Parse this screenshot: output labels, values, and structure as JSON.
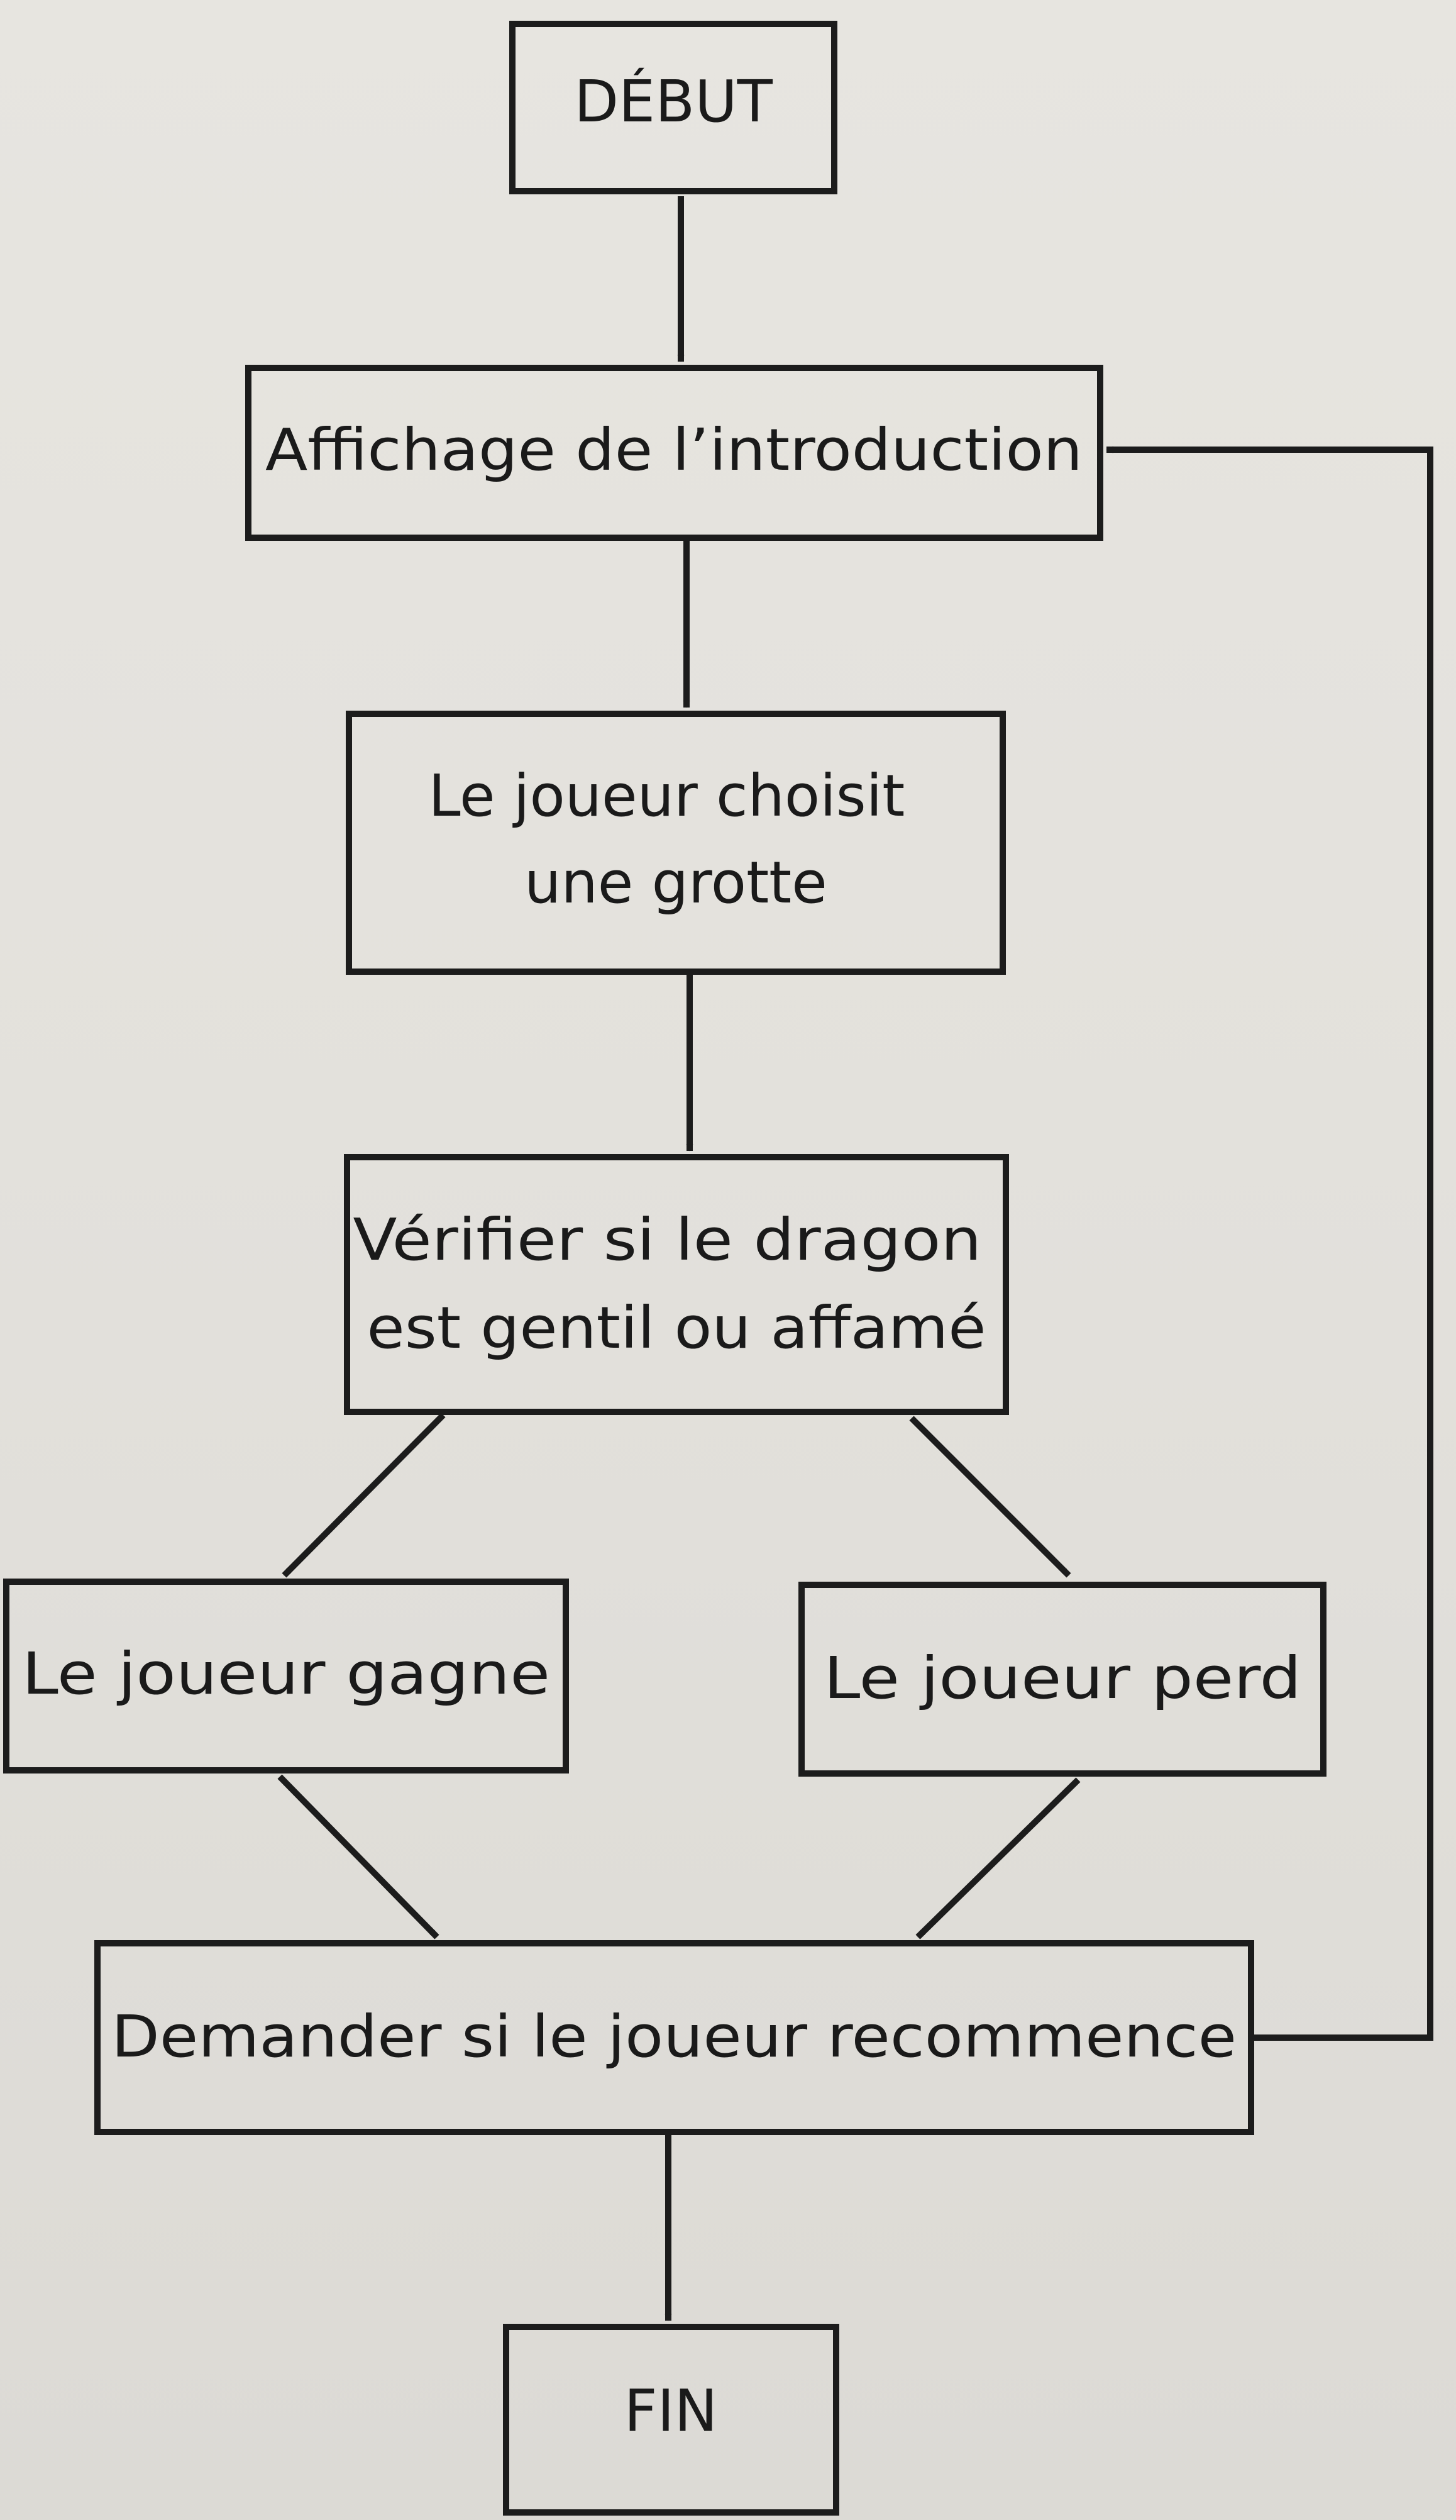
{
  "diagram": {
    "type": "flowchart",
    "nodes": {
      "start": {
        "lines": [
          "DÉBUT"
        ]
      },
      "intro": {
        "lines": [
          "Affichage de l’introduction"
        ]
      },
      "choose": {
        "lines": [
          "Le joueur choisit",
          "une grotte"
        ]
      },
      "check": {
        "lines": [
          "Vérifier si le dragon",
          "est gentil ou affamé"
        ]
      },
      "win": {
        "lines": [
          "Le joueur gagne"
        ]
      },
      "lose": {
        "lines": [
          "Le joueur perd"
        ]
      },
      "replay": {
        "lines": [
          "Demander si le joueur recommence"
        ]
      },
      "end": {
        "lines": [
          "FIN"
        ]
      }
    },
    "edges": [
      {
        "from": "start",
        "to": "intro"
      },
      {
        "from": "intro",
        "to": "choose"
      },
      {
        "from": "choose",
        "to": "check"
      },
      {
        "from": "check",
        "to": "win"
      },
      {
        "from": "check",
        "to": "lose"
      },
      {
        "from": "win",
        "to": "replay"
      },
      {
        "from": "lose",
        "to": "replay"
      },
      {
        "from": "replay",
        "to": "end"
      },
      {
        "from": "replay",
        "to": "intro"
      }
    ]
  },
  "colors": {
    "ink": "#1c1c1c",
    "paper": "#e5e3de"
  }
}
